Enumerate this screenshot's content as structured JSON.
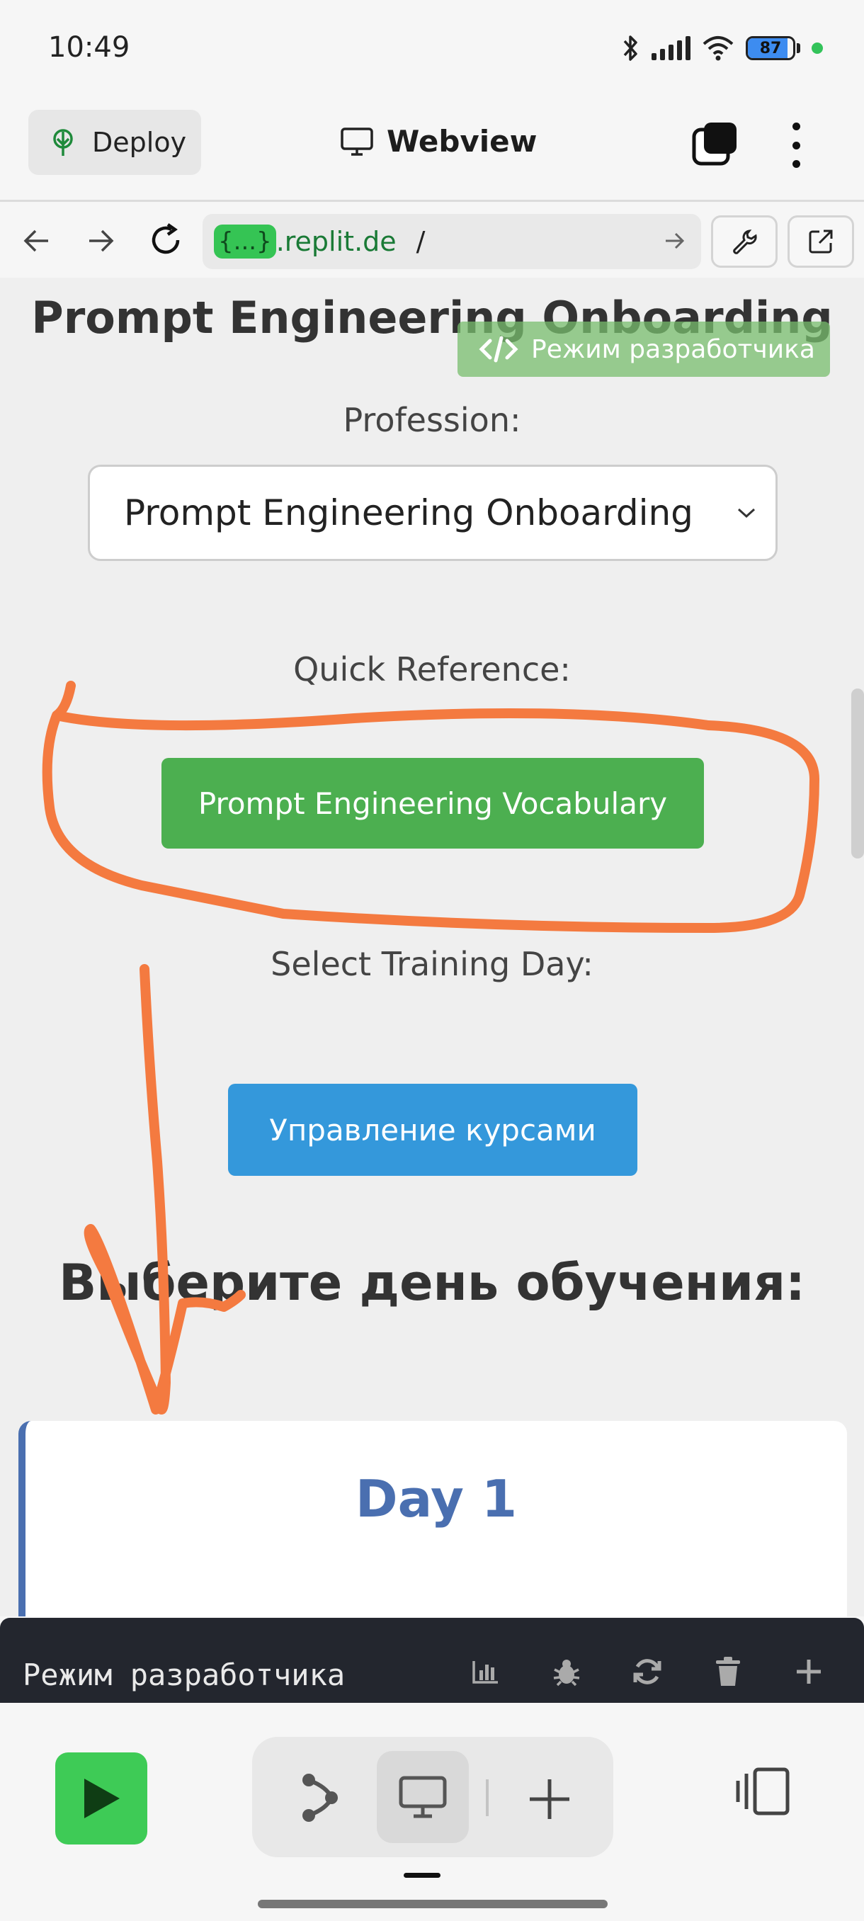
{
  "status_bar": {
    "time": "10:49",
    "battery_level": "87"
  },
  "header": {
    "deploy_label": "Deploy",
    "title": "Webview"
  },
  "url_bar": {
    "chip": "{...}",
    "domain": ".replit.de",
    "path": "/"
  },
  "webview": {
    "page_title": "Prompt Engineering Onboarding",
    "dev_mode_badge": "Режим разработчика",
    "profession_label": "Profession:",
    "profession_selected": "Prompt Engineering Onboarding",
    "quick_reference_label": "Quick Reference:",
    "vocabulary_button": "Prompt Engineering Vocabulary",
    "training_day_label": "Select Training Day:",
    "manage_courses_button": "Управление курсами",
    "select_day_heading": "Выберите день обучения:",
    "day_card_title": "Day 1"
  },
  "console": {
    "label": "Режим разработчика"
  },
  "colors": {
    "vocab_button": "#4caf50",
    "courses_button": "#3498db",
    "day_accent": "#4a6fb0",
    "annotation": "#f47a40",
    "run_button": "#3ecb56"
  }
}
